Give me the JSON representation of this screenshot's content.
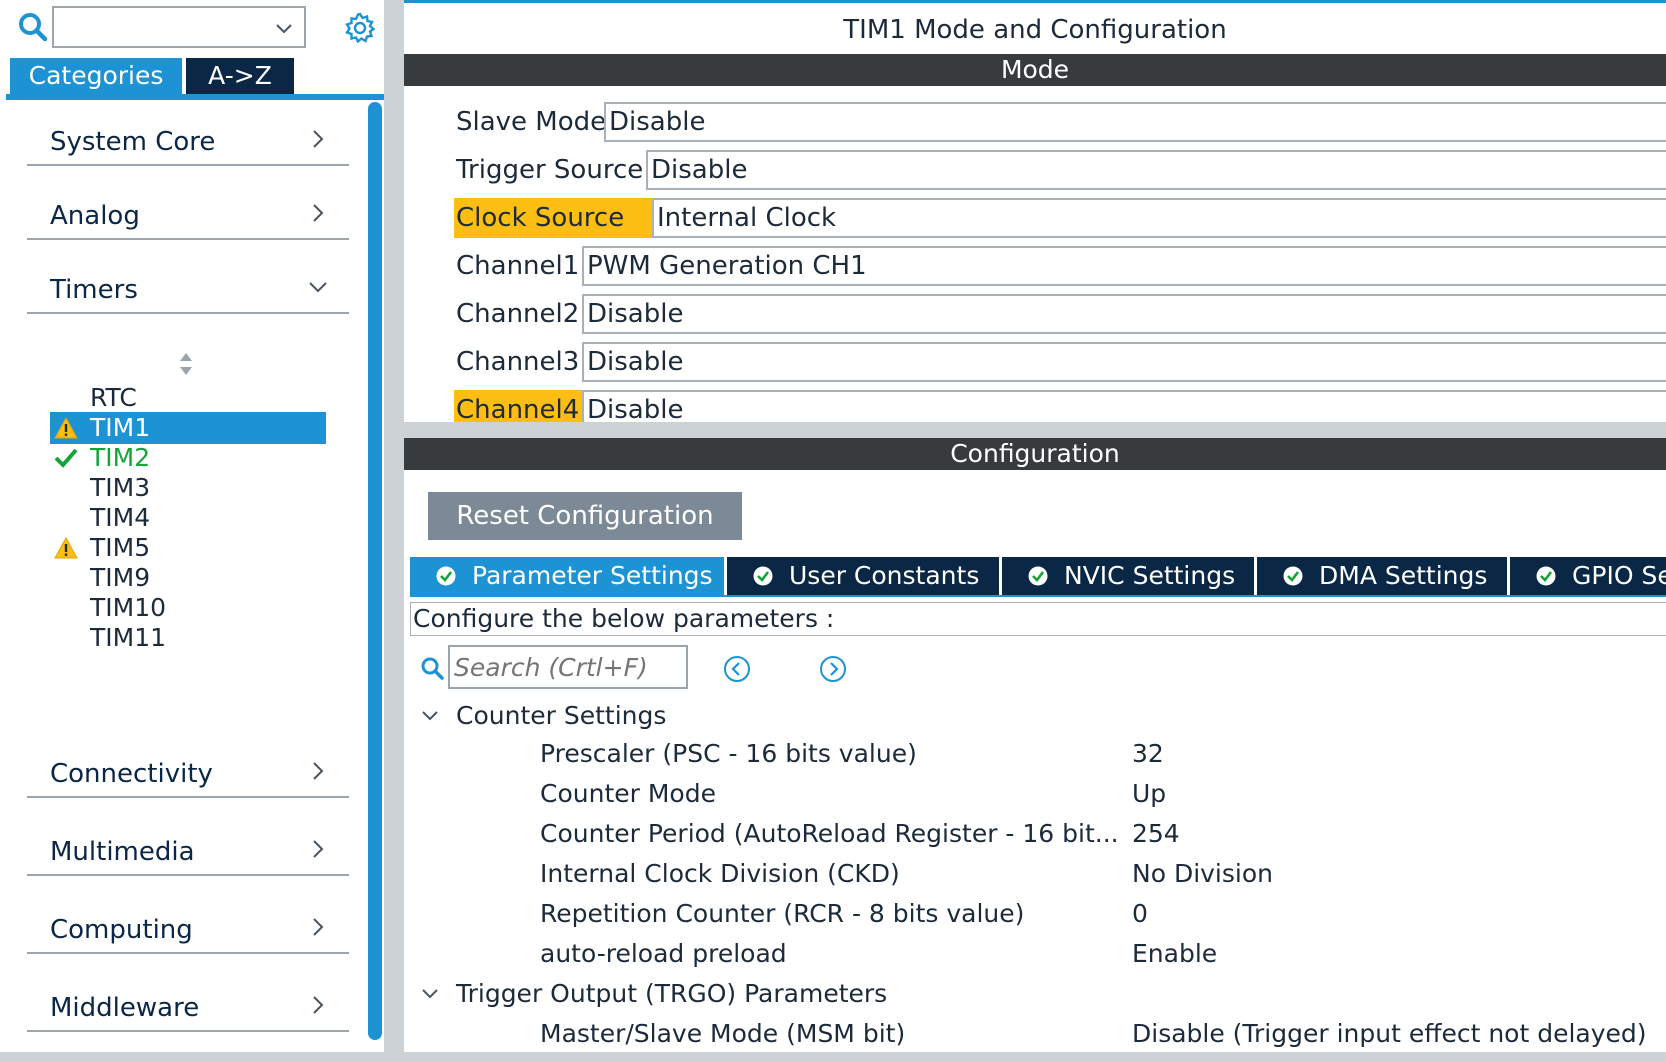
{
  "sidebar": {
    "search_value": "",
    "tabs": {
      "categories": "Categories",
      "az": "A->Z"
    },
    "categories": [
      {
        "label": "System Core",
        "expanded": false
      },
      {
        "label": "Analog",
        "expanded": false
      },
      {
        "label": "Timers",
        "expanded": true
      },
      {
        "label": "Connectivity",
        "expanded": false
      },
      {
        "label": "Multimedia",
        "expanded": false
      },
      {
        "label": "Computing",
        "expanded": false
      },
      {
        "label": "Middleware",
        "expanded": false
      }
    ],
    "timers": [
      {
        "label": "RTC",
        "status": "none"
      },
      {
        "label": "TIM1",
        "status": "warning",
        "selected": true
      },
      {
        "label": "TIM2",
        "status": "ok"
      },
      {
        "label": "TIM3",
        "status": "none"
      },
      {
        "label": "TIM4",
        "status": "none"
      },
      {
        "label": "TIM5",
        "status": "warning"
      },
      {
        "label": "TIM9",
        "status": "none"
      },
      {
        "label": "TIM10",
        "status": "none"
      },
      {
        "label": "TIM11",
        "status": "none"
      }
    ]
  },
  "main": {
    "title": "TIM1 Mode and Configuration",
    "mode_header": "Mode",
    "mode_rows": [
      {
        "label": "Slave Mode",
        "value": "Disable",
        "highlight": false
      },
      {
        "label": "Trigger Source",
        "value": "Disable",
        "highlight": false
      },
      {
        "label": "Clock Source",
        "value": "Internal Clock",
        "highlight": true
      },
      {
        "label": "Channel1",
        "value": "PWM Generation CH1",
        "highlight": false
      },
      {
        "label": "Channel2",
        "value": "Disable",
        "highlight": false
      },
      {
        "label": "Channel3",
        "value": "Disable",
        "highlight": false
      },
      {
        "label": "Channel4",
        "value": "Disable",
        "highlight": true
      }
    ],
    "config_header": "Configuration",
    "reset_button": "Reset Configuration",
    "param_tabs": [
      {
        "label": "Parameter Settings",
        "active": true
      },
      {
        "label": "User Constants",
        "active": false
      },
      {
        "label": "NVIC Settings",
        "active": false
      },
      {
        "label": "DMA Settings",
        "active": false
      },
      {
        "label": "GPIO Settings",
        "active": false
      }
    ],
    "configure_label": "Configure the below parameters :",
    "search_placeholder": "Search (Crtl+F)",
    "sections": [
      {
        "title": "Counter Settings",
        "params": [
          {
            "name": "Prescaler (PSC - 16 bits value)",
            "value": "32"
          },
          {
            "name": "Counter Mode",
            "value": "Up"
          },
          {
            "name": "Counter Period (AutoReload Register - 16 bit...",
            "value": "254"
          },
          {
            "name": "Internal Clock Division (CKD)",
            "value": "No Division"
          },
          {
            "name": "Repetition Counter (RCR - 8 bits value)",
            "value": "0"
          },
          {
            "name": "auto-reload preload",
            "value": "Enable"
          }
        ]
      },
      {
        "title": "Trigger Output (TRGO) Parameters",
        "params": [
          {
            "name": "Master/Slave Mode (MSM bit)",
            "value": "Disable (Trigger input effect not delayed)"
          }
        ]
      }
    ]
  },
  "colors": {
    "accent": "#1e93d3",
    "navy": "#0b2746",
    "header_bar": "#373b3e",
    "highlight": "#fdbe14",
    "ok_green": "#13a538",
    "button_gray": "#7b8a96"
  }
}
